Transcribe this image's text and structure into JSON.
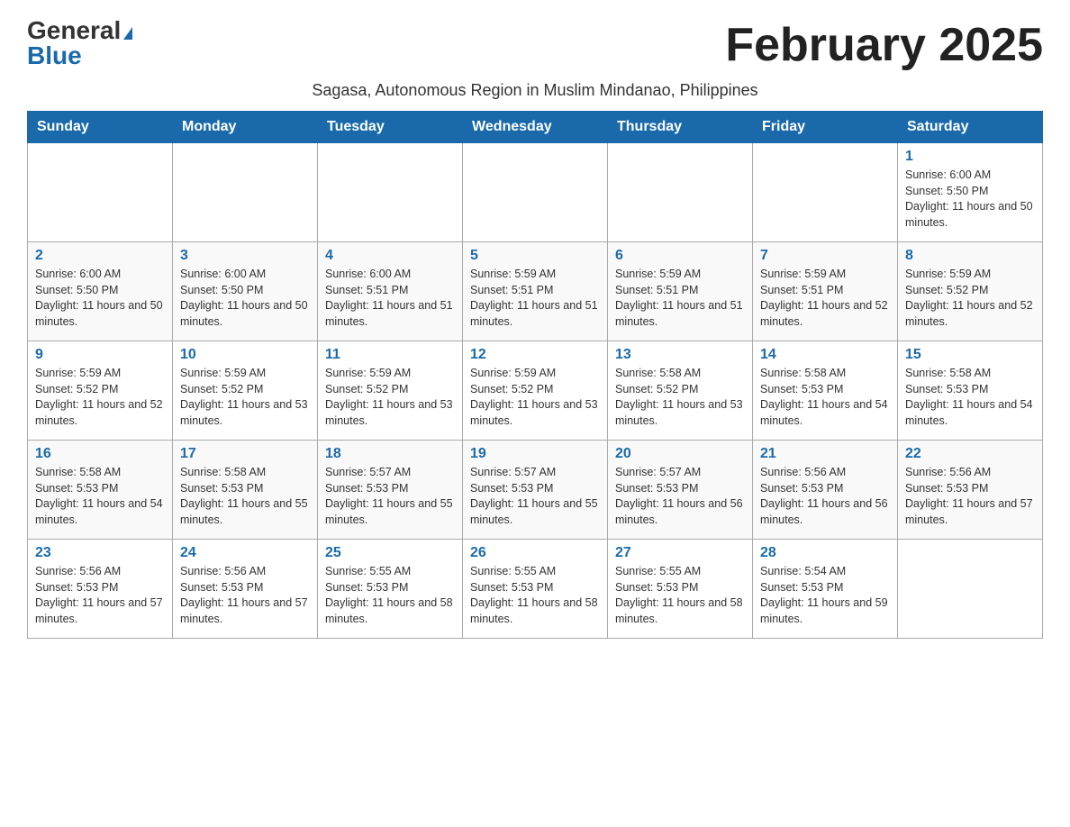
{
  "logo": {
    "general": "General",
    "blue": "Blue"
  },
  "title": "February 2025",
  "subtitle": "Sagasa, Autonomous Region in Muslim Mindanao, Philippines",
  "days_header": [
    "Sunday",
    "Monday",
    "Tuesday",
    "Wednesday",
    "Thursday",
    "Friday",
    "Saturday"
  ],
  "weeks": [
    [
      {
        "day": "",
        "info": ""
      },
      {
        "day": "",
        "info": ""
      },
      {
        "day": "",
        "info": ""
      },
      {
        "day": "",
        "info": ""
      },
      {
        "day": "",
        "info": ""
      },
      {
        "day": "",
        "info": ""
      },
      {
        "day": "1",
        "info": "Sunrise: 6:00 AM\nSunset: 5:50 PM\nDaylight: 11 hours and 50 minutes."
      }
    ],
    [
      {
        "day": "2",
        "info": "Sunrise: 6:00 AM\nSunset: 5:50 PM\nDaylight: 11 hours and 50 minutes."
      },
      {
        "day": "3",
        "info": "Sunrise: 6:00 AM\nSunset: 5:50 PM\nDaylight: 11 hours and 50 minutes."
      },
      {
        "day": "4",
        "info": "Sunrise: 6:00 AM\nSunset: 5:51 PM\nDaylight: 11 hours and 51 minutes."
      },
      {
        "day": "5",
        "info": "Sunrise: 5:59 AM\nSunset: 5:51 PM\nDaylight: 11 hours and 51 minutes."
      },
      {
        "day": "6",
        "info": "Sunrise: 5:59 AM\nSunset: 5:51 PM\nDaylight: 11 hours and 51 minutes."
      },
      {
        "day": "7",
        "info": "Sunrise: 5:59 AM\nSunset: 5:51 PM\nDaylight: 11 hours and 52 minutes."
      },
      {
        "day": "8",
        "info": "Sunrise: 5:59 AM\nSunset: 5:52 PM\nDaylight: 11 hours and 52 minutes."
      }
    ],
    [
      {
        "day": "9",
        "info": "Sunrise: 5:59 AM\nSunset: 5:52 PM\nDaylight: 11 hours and 52 minutes."
      },
      {
        "day": "10",
        "info": "Sunrise: 5:59 AM\nSunset: 5:52 PM\nDaylight: 11 hours and 53 minutes."
      },
      {
        "day": "11",
        "info": "Sunrise: 5:59 AM\nSunset: 5:52 PM\nDaylight: 11 hours and 53 minutes."
      },
      {
        "day": "12",
        "info": "Sunrise: 5:59 AM\nSunset: 5:52 PM\nDaylight: 11 hours and 53 minutes."
      },
      {
        "day": "13",
        "info": "Sunrise: 5:58 AM\nSunset: 5:52 PM\nDaylight: 11 hours and 53 minutes."
      },
      {
        "day": "14",
        "info": "Sunrise: 5:58 AM\nSunset: 5:53 PM\nDaylight: 11 hours and 54 minutes."
      },
      {
        "day": "15",
        "info": "Sunrise: 5:58 AM\nSunset: 5:53 PM\nDaylight: 11 hours and 54 minutes."
      }
    ],
    [
      {
        "day": "16",
        "info": "Sunrise: 5:58 AM\nSunset: 5:53 PM\nDaylight: 11 hours and 54 minutes."
      },
      {
        "day": "17",
        "info": "Sunrise: 5:58 AM\nSunset: 5:53 PM\nDaylight: 11 hours and 55 minutes."
      },
      {
        "day": "18",
        "info": "Sunrise: 5:57 AM\nSunset: 5:53 PM\nDaylight: 11 hours and 55 minutes."
      },
      {
        "day": "19",
        "info": "Sunrise: 5:57 AM\nSunset: 5:53 PM\nDaylight: 11 hours and 55 minutes."
      },
      {
        "day": "20",
        "info": "Sunrise: 5:57 AM\nSunset: 5:53 PM\nDaylight: 11 hours and 56 minutes."
      },
      {
        "day": "21",
        "info": "Sunrise: 5:56 AM\nSunset: 5:53 PM\nDaylight: 11 hours and 56 minutes."
      },
      {
        "day": "22",
        "info": "Sunrise: 5:56 AM\nSunset: 5:53 PM\nDaylight: 11 hours and 57 minutes."
      }
    ],
    [
      {
        "day": "23",
        "info": "Sunrise: 5:56 AM\nSunset: 5:53 PM\nDaylight: 11 hours and 57 minutes."
      },
      {
        "day": "24",
        "info": "Sunrise: 5:56 AM\nSunset: 5:53 PM\nDaylight: 11 hours and 57 minutes."
      },
      {
        "day": "25",
        "info": "Sunrise: 5:55 AM\nSunset: 5:53 PM\nDaylight: 11 hours and 58 minutes."
      },
      {
        "day": "26",
        "info": "Sunrise: 5:55 AM\nSunset: 5:53 PM\nDaylight: 11 hours and 58 minutes."
      },
      {
        "day": "27",
        "info": "Sunrise: 5:55 AM\nSunset: 5:53 PM\nDaylight: 11 hours and 58 minutes."
      },
      {
        "day": "28",
        "info": "Sunrise: 5:54 AM\nSunset: 5:53 PM\nDaylight: 11 hours and 59 minutes."
      },
      {
        "day": "",
        "info": ""
      }
    ]
  ]
}
